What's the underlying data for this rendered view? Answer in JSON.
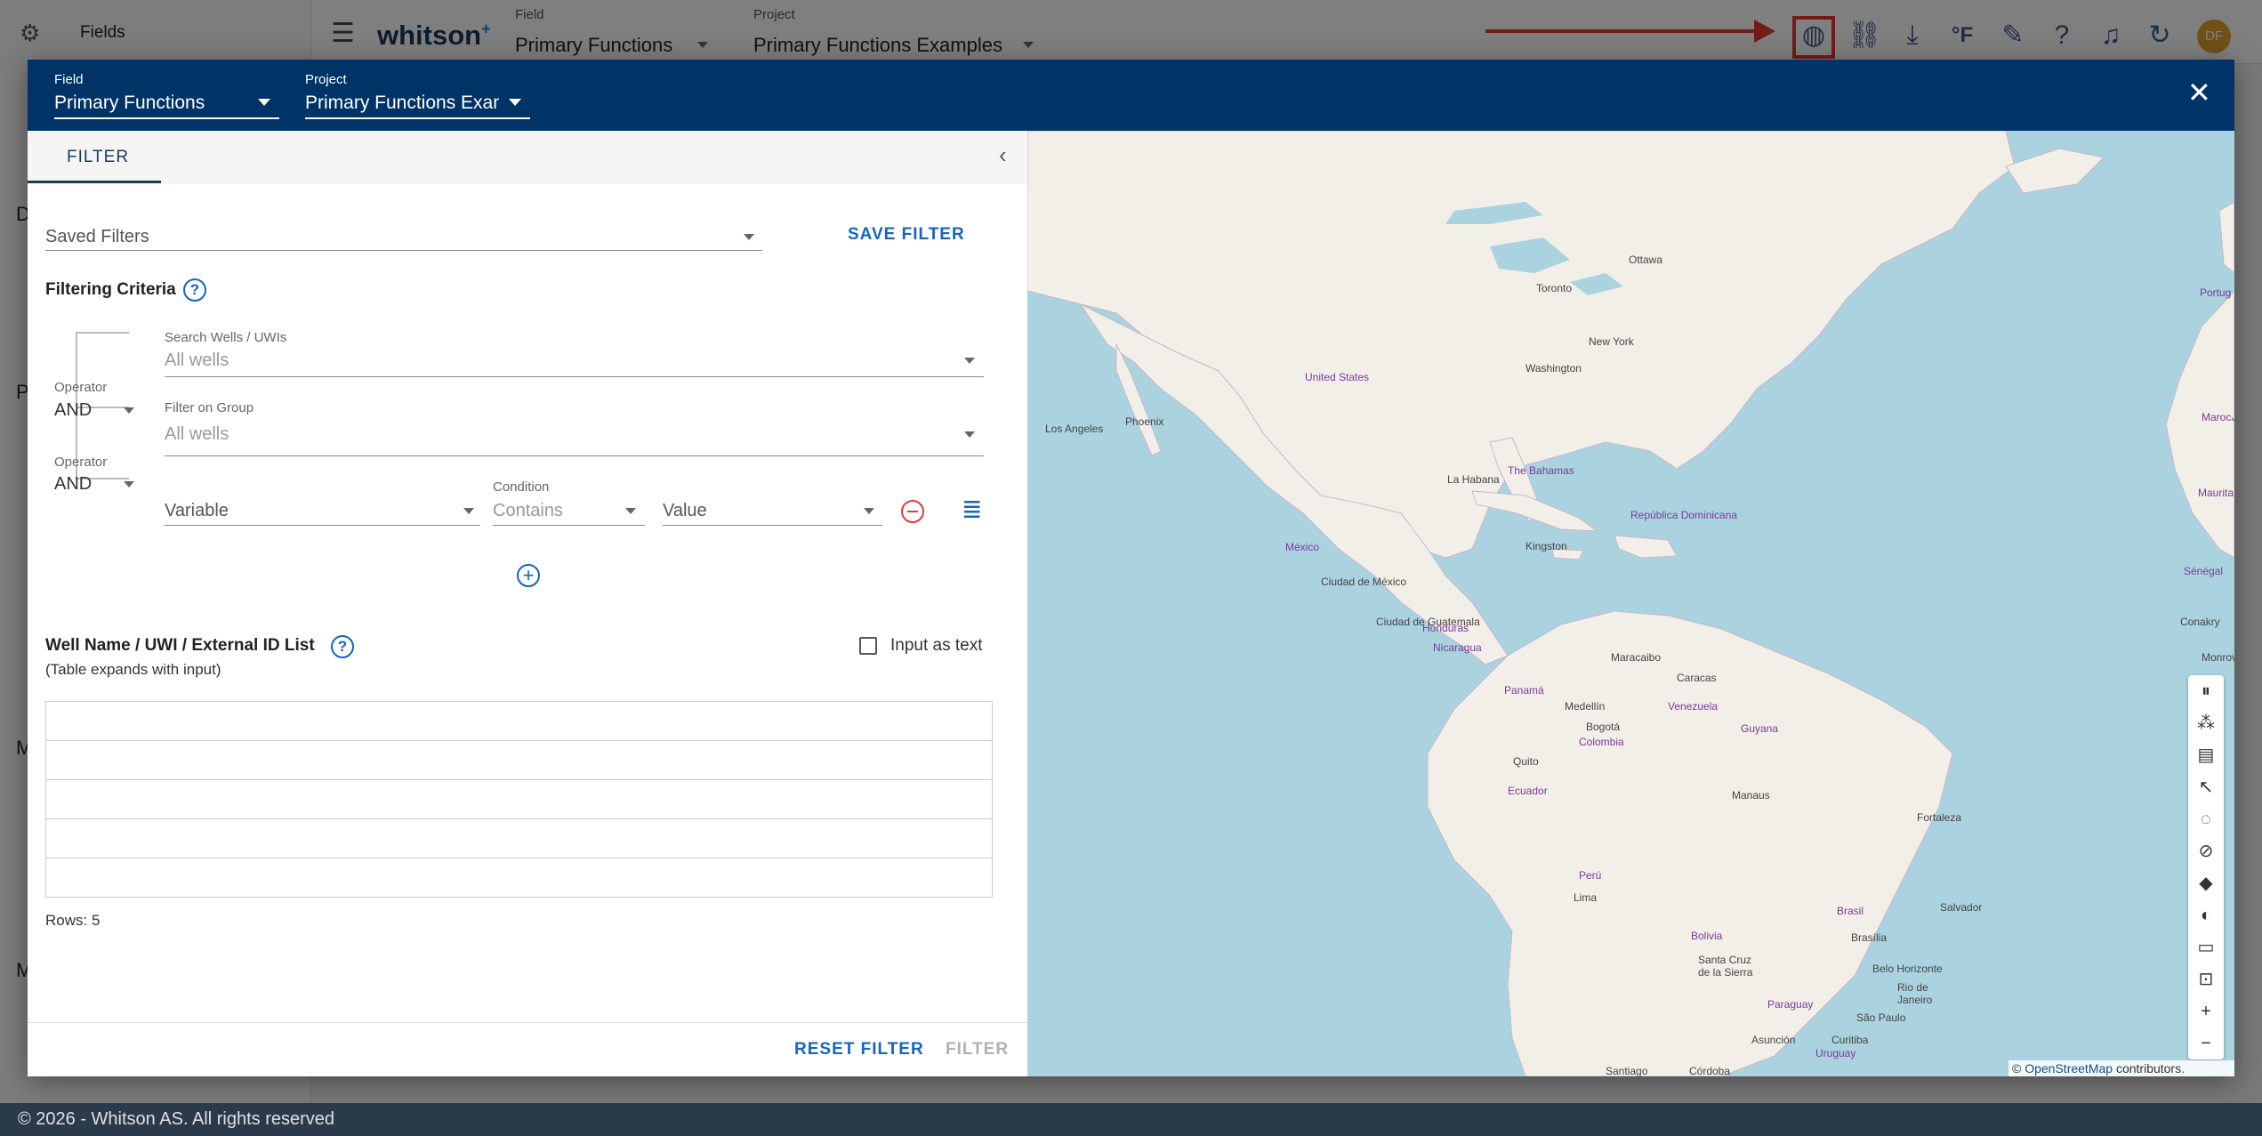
{
  "background": {
    "sidebar_title": "Fields",
    "logo": "whitson",
    "logo_sup": "+",
    "field_label": "Field",
    "field_value": "Primary Functions",
    "project_label": "Project",
    "project_value": "Primary Functions Examples",
    "sidebar_letters": [
      "D",
      "P",
      "M",
      "M"
    ],
    "avatar_initials": "DF",
    "temp_unit": "°F"
  },
  "modal": {
    "field_label": "Field",
    "field_value": "Primary Functions",
    "project_label": "Project",
    "project_value": "Primary Functions Examples"
  },
  "filter": {
    "tab_label": "FILTER",
    "saved_filters_placeholder": "Saved Filters",
    "save_filter": "SAVE FILTER",
    "criteria_title": "Filtering Criteria",
    "search_label": "Search Wells / UWIs",
    "search_value": "All wells",
    "operator_label": "Operator",
    "operator1_value": "AND",
    "group_label": "Filter on Group",
    "group_value": "All wells",
    "operator2_value": "AND",
    "variable_placeholder": "Variable",
    "condition_label": "Condition",
    "condition_value": "Contains",
    "value_placeholder": "Value",
    "list_title": "Well Name / UWI / External ID List",
    "list_subtitle": "(Table expands with input)",
    "input_as_text": "Input as text",
    "rows_label": "Rows: 5",
    "reset_filter": "RESET FILTER",
    "filter_button": "FILTER"
  },
  "map": {
    "attribution_prefix": "©",
    "attribution_link": "OpenStreetMap",
    "attribution_suffix": "contributors.",
    "labels": {
      "ottawa": "Ottawa",
      "toronto": "Toronto",
      "newyork": "New York",
      "washington": "Washington",
      "us": "United States",
      "la": "Los Angeles",
      "phoenix": "Phoenix",
      "mexico": "México",
      "cdmx": "Ciudad de México",
      "habana": "La Habana",
      "bahamas": "The Bahamas",
      "rd": "República Dominicana",
      "kingston": "Kingston",
      "guatemala": "Ciudad de Guatemala",
      "honduras": "Honduras",
      "nicaragua": "Nicaragua",
      "panama": "Panamá",
      "maracaibo": "Maracaibo",
      "caracas": "Caracas",
      "venezuela": "Venezuela",
      "guyana": "Guyana",
      "medellin": "Medellín",
      "bogota": "Bogotá",
      "colombia": "Colombia",
      "quito": "Quito",
      "ecuador": "Ecuador",
      "peru": "Perú",
      "lima": "Lima",
      "manaus": "Manaus",
      "fortaleza": "Fortaleza",
      "salvador": "Salvador",
      "brasil": "Brasil",
      "brasilia": "Brasília",
      "bolivia": "Bolivia",
      "santacruz": "Santa Cruz de la Sierra",
      "bh": "Belo Horizonte",
      "rio": "Rio de Janeiro",
      "saopaulo": "São Paulo",
      "paraguay": "Paraguay",
      "asuncion": "Asunción",
      "curitiba": "Curitiba",
      "cordoba": "Córdoba",
      "uruguay": "Uruguay",
      "santiago": "Santiago",
      "maroc": "Marocالمغرب",
      "mauritanie": "Mauritanie موريتانيا",
      "senegal": "Sénégal",
      "conakry": "Conakry",
      "monrovia": "Monrovia",
      "portugal": "Portug"
    }
  }
}
